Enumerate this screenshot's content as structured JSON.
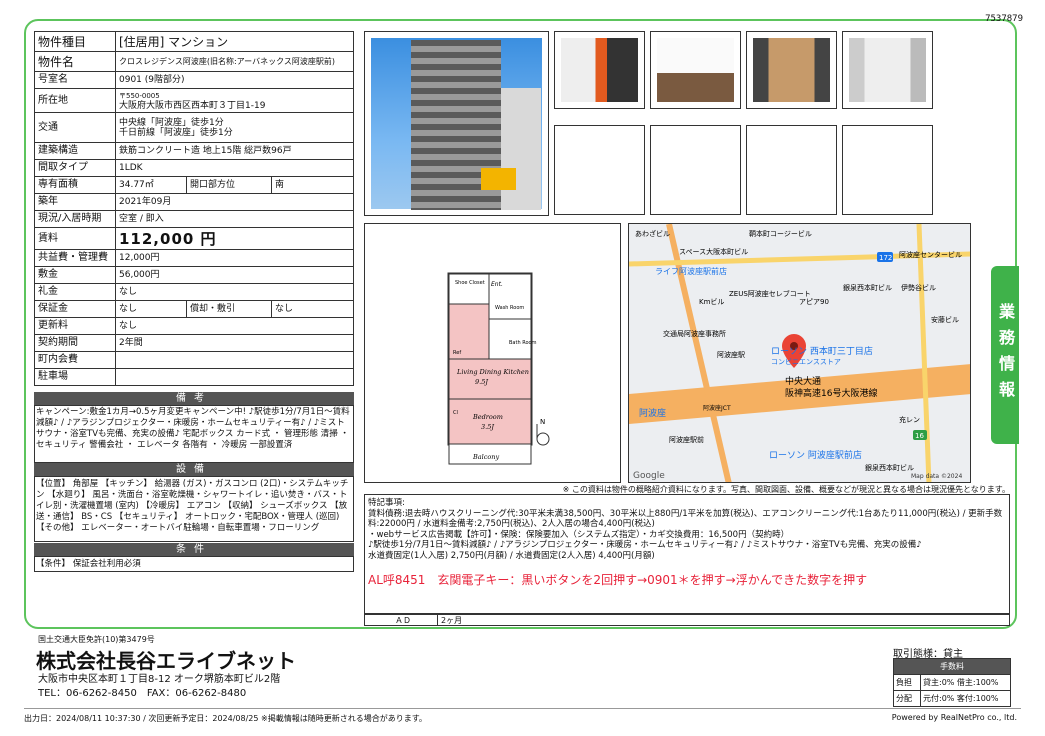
{
  "doc_id": "7537879",
  "table": {
    "type_label": "物件種目",
    "type_value": "[住居用] マンション",
    "name_label": "物件名",
    "name_value": "クロスレジデンス阿波座(旧名称:アーバネックス阿波座駅前)",
    "room_label": "号室名",
    "room_value": "0901 (9階部分)",
    "addr_label": "所在地",
    "zip": "〒550-0005",
    "addr_value": "大阪府大阪市西区西本町３丁目1-19",
    "access_label": "交通",
    "access1": "中央線「阿波座」徒歩1分",
    "access2": "千日前線「阿波座」徒歩1分",
    "struct_label": "建築構造",
    "struct_value": "鉄筋コンクリート造 地上15階 総戸数96戸",
    "layout_label": "間取タイプ",
    "layout_value": "1LDK",
    "area_label": "専有面積",
    "area_value": "34.77㎡",
    "dir_label": "開口部方位",
    "dir_value": "南",
    "built_label": "築年",
    "built_value": "2021年09月",
    "status_label": "現況/入居時期",
    "status_value": "空室 / 即入",
    "rent_label": "賃料",
    "rent_value": "112,000 円",
    "mgmt_label": "共益費・管理費",
    "mgmt_value": "12,000円",
    "deposit_label": "敷金",
    "deposit_value": "56,000円",
    "key_label": "礼金",
    "key_value": "なし",
    "guar_label": "保証金",
    "guar_value": "なし",
    "amort_label": "償却・敷引",
    "amort_value": "なし",
    "renew_label": "更新料",
    "renew_value": "なし",
    "term_label": "契約期間",
    "term_value": "2年間",
    "town_label": "町内会費",
    "town_value": "",
    "park_label": "駐車場",
    "park_value": ""
  },
  "remarks": {
    "title": "備考",
    "text": "キャンペーン:敷金1カ月→0.5ヶ月変更キャンペーン中! ♪駅徒歩1分/7月1日～賃料減額♪ / ♪アラジンプロジェクター・床暖房・ホームセキュリティー有♪ / ♪ミストサウナ・浴室TVも完備、充実の設備♪ 宅配ボックス カード式 ・ 管理形態 清掃 ・ セキュリティ 警備会社 ・ エレベータ 各階有 ・ 冷暖房 一部設置済"
  },
  "equipment": {
    "title": "設備",
    "text": "【位置】 角部屋 【キッチン】 給湯器 (ガス)・ガスコンロ (2口)・システムキッチン 【水廻り】 風呂・洗面台・浴室乾燥機・シャワートイレ・追い焚き・バス・トイレ別・洗濯機置場 (室内) 【冷暖房】 エアコン 【収納】 シューズボックス 【放送・通信】 BS・CS 【セキュリティ】 オートロック・宅配BOX・管理人 (巡回) 【その他】 エレベーター・オートバイ駐輪場・自転車置場・フローリング"
  },
  "conditions": {
    "title": "条件",
    "text": "【条件】 保証会社利用必須"
  },
  "floorplan": {
    "ent": "Ent.",
    "closet": "Shoe Closet",
    "wash": "Wash Room",
    "bath": "Bath Room",
    "ref": "Ref",
    "ldk": "Living Dining Kitchen",
    "ldk_size": "9.5J",
    "cl": "Cl",
    "bed": "Bedroom",
    "bed_size": "3.5J",
    "balcony": "Balcony",
    "north": "N"
  },
  "map": {
    "labels": [
      "あわざビル",
      "鞆本町コージービル",
      "スペース大阪本町ビル",
      "阿波座センタービル",
      "ライフ阿波座駅前店",
      "銀泉西本町ビル",
      "伊勢谷ビル",
      "Kmビル",
      "アピア90",
      "ZEUS阿波座セレブコート",
      "安藤ビル",
      "交通局阿波座事務所",
      "ローソン 西本町三丁目店",
      "コンビニエンスストア",
      "阿波座駅",
      "中央大通",
      "阪神高速16号大阪港線",
      "阿波座JCT",
      "阿波座",
      "阿波座駅前",
      "充レン",
      "ローソン 阿波座駅前店",
      "銀泉西本町ビル"
    ],
    "shield1": "172",
    "shield2": "16",
    "google": "Google",
    "copyright": "Map data ©2024"
  },
  "disclaimer": "※ この資料は物件の概略紹介資料になります。写真、間取図面、設備、概要などが現況と異なる場合は現況優先となります。",
  "special": {
    "title": "特記事項:",
    "lines": [
      "賃料債務:退去時ハウスクリーニング代:30平米未満38,500円、30平米以上880円/1平米を加算(税込)、エアコンクリーニング代:1台あたり11,000円(税込) / 更新手数料:22000円 / 水道料金備考:2,750円(税込)、2人入居の場合4,400円(税込)",
      "・webサービス広告掲載【許可】・保険：保険要加入（システムズ指定）・カギ交換費用：16,500円（契約時）",
      "♪駅徒歩1分/7月1日～賃料減額♪ / ♪アラジンプロジェクター・床暖房・ホームセキュリティー有♪ / ♪ミストサウナ・浴室TVも完備、充実の設備♪",
      "水道費固定(1人入居) 2,750円(月額) / 水道費固定(2人入居) 4,400円(月額)"
    ],
    "red": "AL呼8451　玄関電子キー：黒いボタンを2回押す→0901＊を押す→浮かんできた数字を押す"
  },
  "ad": {
    "label": "ＡＤ",
    "value": "2ヶ月"
  },
  "side_tab": "業務情報",
  "company": {
    "license": "国土交通大臣免許(10)第3479号",
    "name": "株式会社長谷エライブネット",
    "address": "大阪市中央区本町１丁目8-12 オーク堺筋本町ビル2階",
    "tel": "TEL：06-6262-8450　FAX：06-6262-8480"
  },
  "fee": {
    "title": "取引態様：貸主",
    "header": "手数料",
    "r1_label": "負担",
    "r1_value": "貸主:0% 借主:100%",
    "r2_label": "分配",
    "r2_value": "元付:0% 客付:100%"
  },
  "footer": {
    "left": "出力日：2024/08/11 10:37:30 / 次回更新予定日：2024/08/25 ※掲載情報は随時更新される場合があります。",
    "right": "Powered by RealNetPro co., ltd."
  },
  "colors": {
    "frame": "#5cc45c",
    "tab": "#3fb24a",
    "red_text": "#e8233a",
    "section_bar": "#555555"
  }
}
